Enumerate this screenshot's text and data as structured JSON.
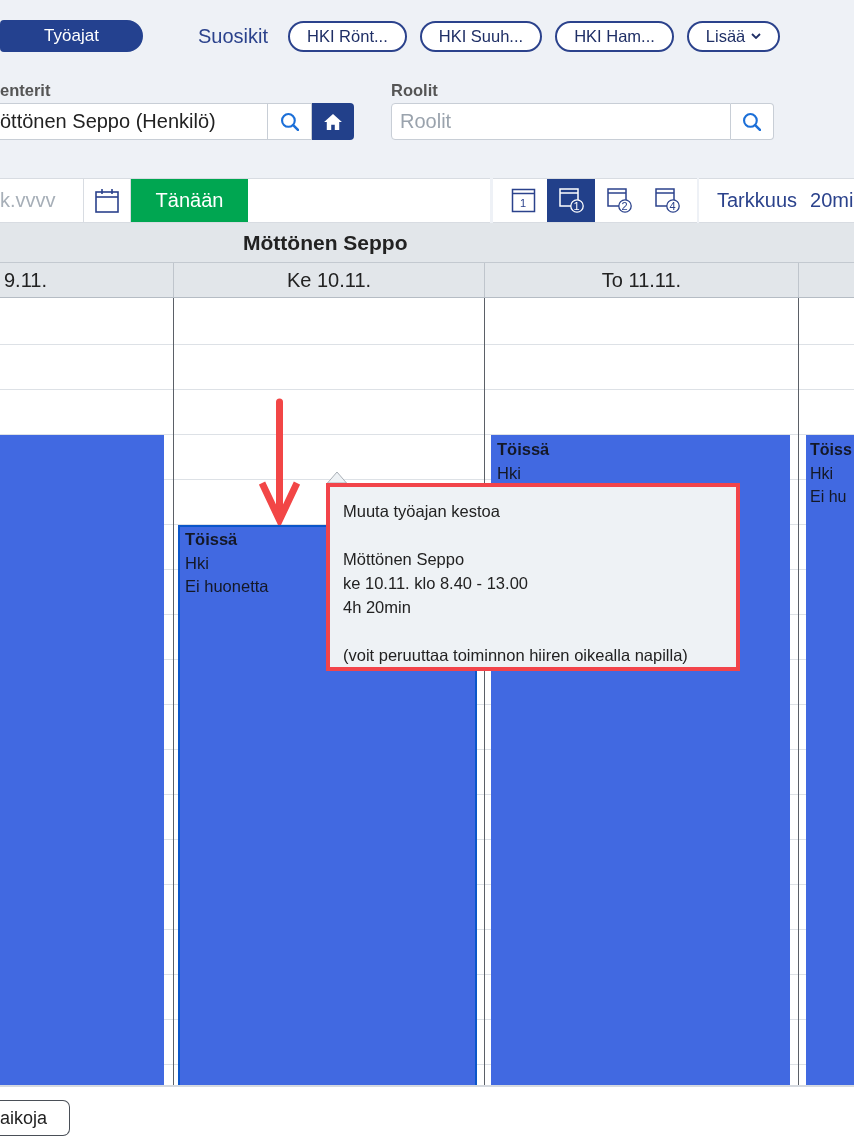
{
  "nav": {
    "tabs": [
      {
        "label": "Työajat",
        "selected": true
      }
    ],
    "favorites_label": "Suosikit",
    "favorites": [
      "HKI Rönt...",
      "HKI Suuh...",
      "HKI Ham..."
    ],
    "more": "Lisää"
  },
  "filters": {
    "calendars": {
      "label": "enterit",
      "value": "öttönen Seppo (Henkilö)"
    },
    "roles": {
      "label": "Roolit",
      "placeholder": "Roolit"
    }
  },
  "toolbar": {
    "date": {
      "placeholder": "k.vvvv"
    },
    "today": "Tänään",
    "views": [
      {
        "kind": "plain",
        "label": "1",
        "selected": false
      },
      {
        "kind": "circled",
        "label": "1",
        "selected": true
      },
      {
        "kind": "circled",
        "label": "2",
        "selected": false
      },
      {
        "kind": "circled",
        "label": "4",
        "selected": false
      }
    ],
    "precision": {
      "label": "Tarkkuus",
      "value": "20mi"
    }
  },
  "calendar": {
    "person": "Möttönen Seppo",
    "days": [
      {
        "label": "9.11.",
        "event": {
          "selected": false
        }
      },
      {
        "label": "Ke 10.11.",
        "event": {
          "selected": true,
          "title": "Töissä",
          "place": "Hki",
          "room": "Ei huonetta"
        }
      },
      {
        "label": "To 11.11.",
        "event": {
          "selected": false,
          "title": "Töissä",
          "place": "Hki"
        }
      },
      {
        "event": {
          "selected": false,
          "title": "Töiss",
          "place": "Hki",
          "room": "Ei hu"
        }
      }
    ]
  },
  "tooltip": {
    "title": "Muuta työajan kestoa",
    "details": [
      "Möttönen Seppo",
      "ke 10.11. klo 8.40 - 13.00",
      "4h 20min"
    ],
    "hint": "(voit peruuttaa toiminnon hiiren oikealla napilla)"
  },
  "footer": {
    "button": "aikoja"
  }
}
